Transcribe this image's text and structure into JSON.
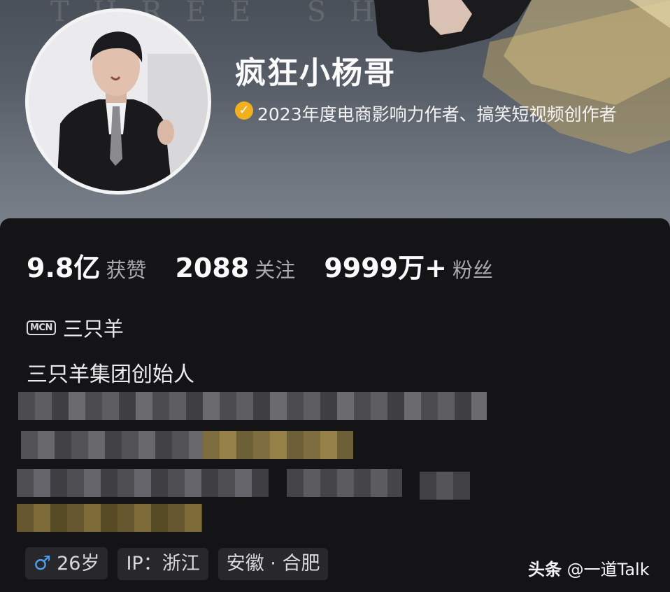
{
  "banner": {
    "watermark_text": "THREE SHEEP"
  },
  "profile": {
    "name": "疯狂小杨哥",
    "verification": "2023年度电商影响力作者、搞笑短视频创作者",
    "verify_icon": "check-badge-icon",
    "verify_color": "#f2b01e"
  },
  "stats": [
    {
      "value": "9.8亿",
      "label": "获赞"
    },
    {
      "value": "2088",
      "label": "关注"
    },
    {
      "value": "9999万+",
      "label": "粉丝"
    }
  ],
  "mcn": {
    "badge": "MCN",
    "name": "三只羊"
  },
  "bio": {
    "first_line": "三只羊集团创始人"
  },
  "tags": {
    "age": "26岁",
    "ip": "IP：浙江",
    "location": "安徽 · 合肥",
    "gender_icon": "male-icon"
  },
  "watermark": {
    "brand": "头条",
    "handle": "@一道Talk"
  }
}
